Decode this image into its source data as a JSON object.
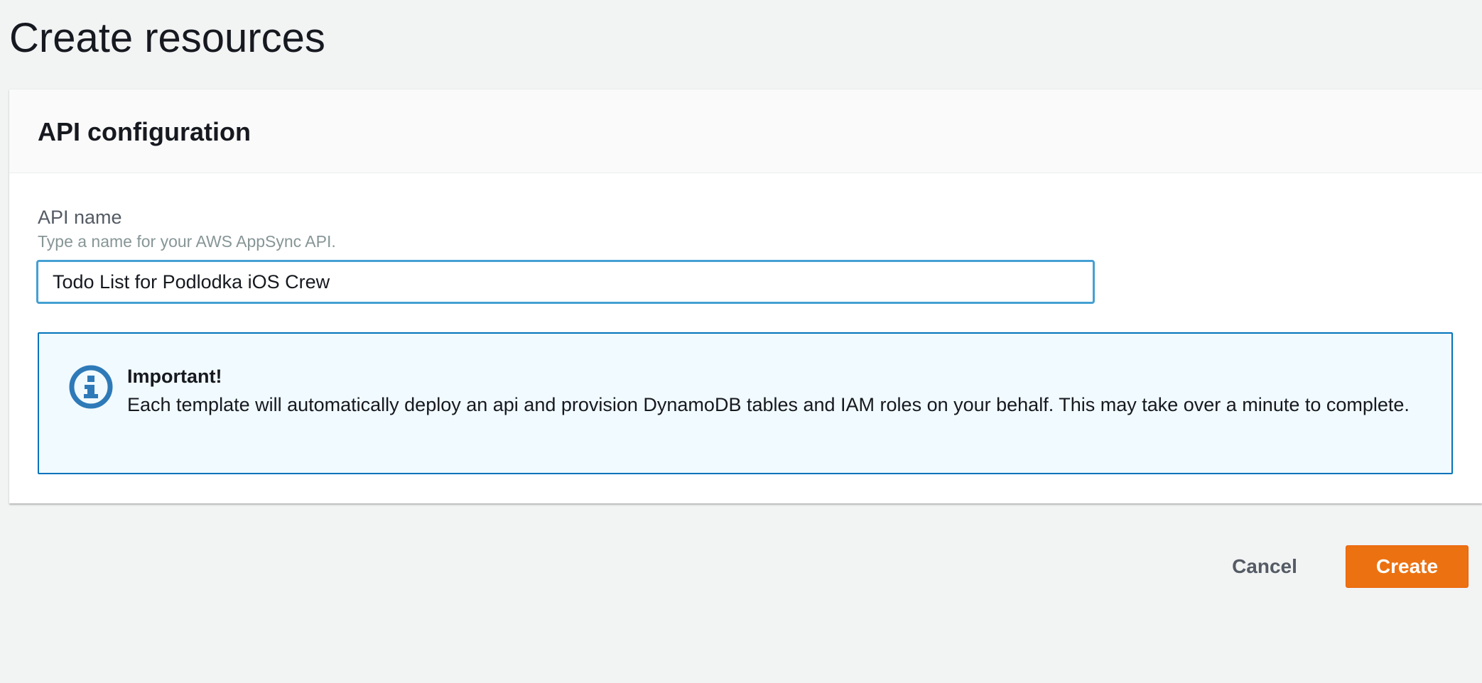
{
  "page": {
    "title": "Create resources"
  },
  "api_configuration": {
    "heading": "API configuration",
    "api_name": {
      "label": "API name",
      "description": "Type a name for your AWS AppSync API.",
      "value": "Todo List for Podlodka iOS Crew"
    },
    "alert": {
      "icon": "info-icon",
      "title": "Important!",
      "body": "Each template will automatically deploy an api and provision DynamoDB tables and IAM roles on your behalf. This may take over a minute to complete."
    }
  },
  "actions": {
    "cancel_label": "Cancel",
    "create_label": "Create"
  },
  "colors": {
    "background": "#f2f3f3",
    "primary_button": "#ec7211",
    "input_focus_border": "#44a0d3",
    "info_border": "#0073bb",
    "info_background": "#f1faff",
    "info_icon": "#2e7ab8"
  }
}
